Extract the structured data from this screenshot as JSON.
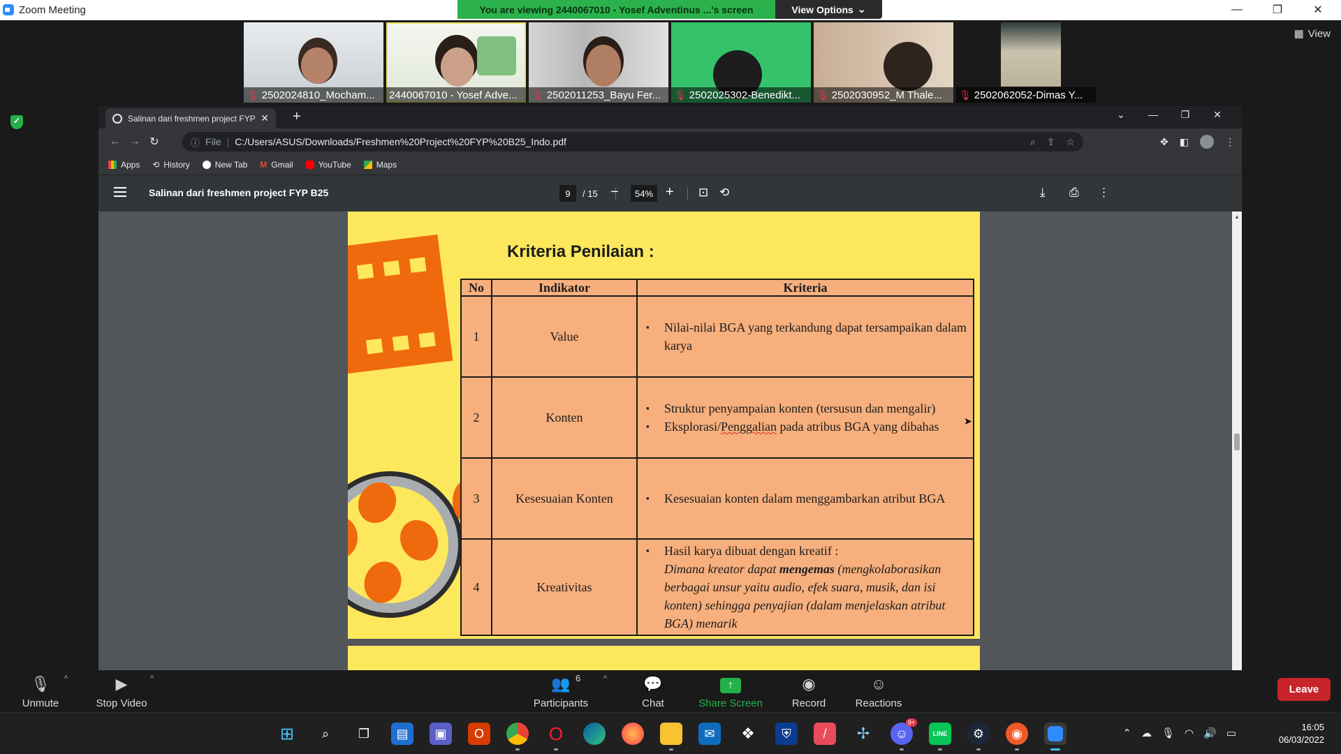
{
  "zoom": {
    "window_title": "Zoom Meeting",
    "viewing_banner": "You are viewing 2440067010 - Yosef Adventinus ...'s screen",
    "view_options_label": "View Options",
    "view_button_label": "View",
    "participants": [
      {
        "name": "2502024810_Mocham...",
        "muted": true
      },
      {
        "name": "2440067010 - Yosef Adve...",
        "muted": false,
        "active": true
      },
      {
        "name": "2502011253_Bayu Fer...",
        "muted": true
      },
      {
        "name": "2502025302-Benedikt...",
        "muted": true
      },
      {
        "name": "2502030952_M Thale...",
        "muted": true
      },
      {
        "name": "2502062052-Dimas Y...",
        "muted": true
      }
    ],
    "controls": {
      "unmute": "Unmute",
      "stop_video": "Stop Video",
      "participants": "Participants",
      "participants_count": "6",
      "chat": "Chat",
      "share_screen": "Share Screen",
      "record": "Record",
      "reactions": "Reactions",
      "leave": "Leave"
    }
  },
  "chrome": {
    "tab_title": "Salinan dari freshmen project FYP",
    "address_scheme": "File",
    "address_url": "C:/Users/ASUS/Downloads/Freshmen%20Project%20FYP%20B25_Indo.pdf",
    "bookmarks": [
      "Apps",
      "History",
      "New Tab",
      "Gmail",
      "YouTube",
      "Maps"
    ]
  },
  "pdf": {
    "title": "Salinan dari freshmen project FYP B25",
    "current_page": "9",
    "total_pages": "/ 15",
    "zoom": "54%"
  },
  "document": {
    "heading": "Kriteria Penilaian :",
    "table_headers": [
      "No",
      "Indikator",
      "Kriteria"
    ],
    "rows": [
      {
        "no": "1",
        "indikator": "Value",
        "kriteria": [
          "Nilai-nilai BGA yang terkandung dapat tersampaikan dalam karya"
        ]
      },
      {
        "no": "2",
        "indikator": "Konten",
        "kriteria": [
          "Struktur penyampaian konten (tersusun dan mengalir)",
          "Eksplorasi/Penggalian pada atribus BGA yang dibahas"
        ]
      },
      {
        "no": "3",
        "indikator": "Kesesuaian Konten",
        "kriteria": [
          "Kesesuaian konten dalam menggambarkan atribut BGA"
        ]
      },
      {
        "no": "4",
        "indikator": "Kreativitas",
        "kriteria_intro": "Hasil karya dibuat dengan kreatif :",
        "kriteria_italic_1": "Dimana kreator dapat ",
        "kriteria_bold": "mengemas",
        "kriteria_italic_2": " (mengkolaborasikan berbagai unsur yaitu audio, efek suara, musik, dan isi konten) sehingga penyajian (dalam menjelaskan atribut BGA) menarik"
      }
    ]
  },
  "taskbar": {
    "time": "16:05",
    "date": "06/03/2022",
    "discord_badge": "9+"
  },
  "colors": {
    "zoom_green": "#2bb24c",
    "leave_red": "#c8242c",
    "page_yellow": "#fde85d",
    "accent_orange": "#ef6a0c",
    "table_salmon": "#f6af7d"
  }
}
